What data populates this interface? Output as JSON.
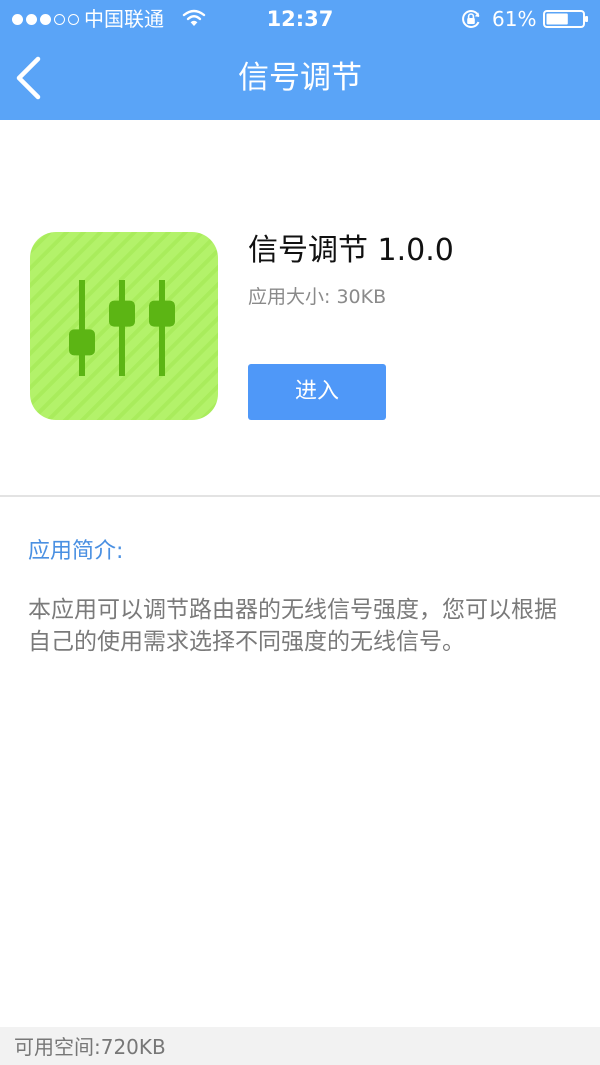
{
  "status_bar": {
    "carrier": "中国联通",
    "time": "12:37",
    "battery": "61%",
    "signal_bars_filled": 3,
    "signal_bars_total": 5,
    "battery_level": 0.61,
    "icons": [
      "signal-dots-icon",
      "wifi-icon",
      "rotation-lock-icon",
      "battery-icon"
    ]
  },
  "nav": {
    "title": "信号调节",
    "back_icon": "chevron-left-icon"
  },
  "app": {
    "name": "信号调节 1.0.0",
    "size": "应用大小: 30KB",
    "enter_label": "进入",
    "icon": "equalizer-sliders-icon",
    "slider_levels": [
      0.35,
      0.65,
      0.65
    ]
  },
  "intro": {
    "heading": "应用简介:",
    "body": "本应用可以调节路由器的无线信号强度，您可以根据自己的使用需求选择不同强度的无线信号。"
  },
  "footer": {
    "available_space": "可用空间:720KB"
  },
  "colors": {
    "nav_background": "#5aa4f7",
    "button": "#4f98f8",
    "heading_accent": "#4a90e2",
    "icon_background": "#b3f26a",
    "icon_slider": "#5cb514"
  }
}
